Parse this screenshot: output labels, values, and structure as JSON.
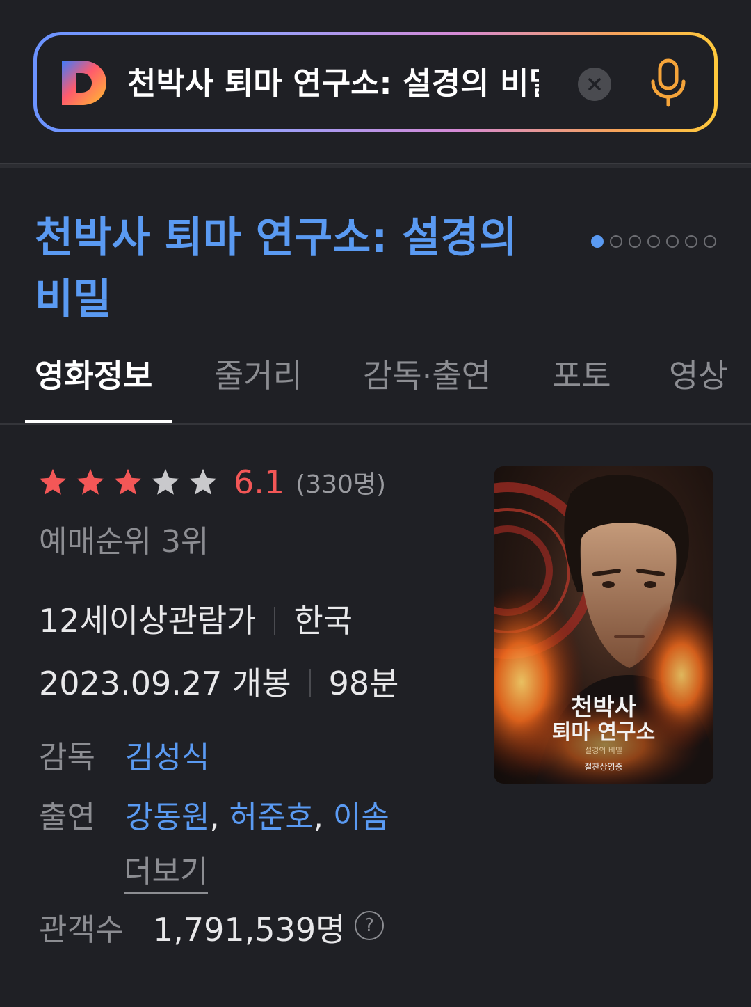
{
  "search": {
    "query": "천박사 퇴마 연구소: 설경의 비밀",
    "logo_letter": "D",
    "clear_icon": "close-icon",
    "mic_icon": "microphone-icon"
  },
  "movie": {
    "title": "천박사 퇴마 연구소: 설경의 비밀",
    "pager_total": 7,
    "pager_active": 0
  },
  "tabs": [
    {
      "label": "영화정보",
      "active": true
    },
    {
      "label": "줄거리",
      "active": false
    },
    {
      "label": "감독·출연",
      "active": false
    },
    {
      "label": "포토",
      "active": false
    },
    {
      "label": "영상",
      "active": false
    }
  ],
  "rating": {
    "stars_filled": 3,
    "stars_total": 5,
    "score": "6.1",
    "count": "(330명)"
  },
  "rank": "예매순위 3위",
  "info": {
    "age": "12세이상관람가",
    "country": "한국",
    "release": "2023.09.27 개봉",
    "runtime": "98분"
  },
  "director": {
    "label": "감독",
    "name": "김성식"
  },
  "cast": {
    "label": "출연",
    "names": [
      "강동원",
      "허준호",
      "이솜"
    ],
    "comma": ",",
    "more": "더보기"
  },
  "audience": {
    "label": "관객수",
    "value": "1,791,539명",
    "help": "?"
  },
  "poster": {
    "title_line1": "천박사",
    "title_line2": "퇴마 연구소",
    "subtitle": "설경의 비밀",
    "tagline": "절찬상영중"
  },
  "colors": {
    "accent_blue": "#5a9af2",
    "rating_red": "#f35757",
    "star_grey": "#c9c9cc",
    "background": "#1f2025"
  }
}
